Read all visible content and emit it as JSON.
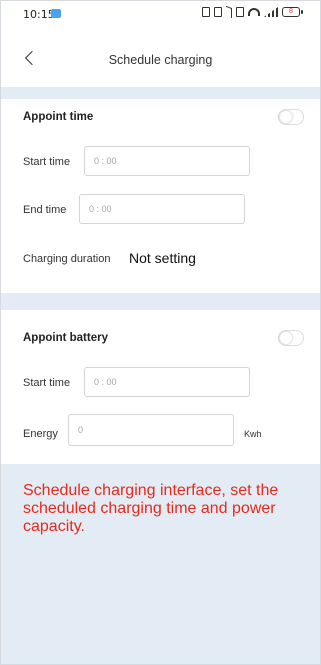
{
  "status_bar": {
    "time": "10:15",
    "battery": "8"
  },
  "header": {
    "title": "Schedule charging"
  },
  "appoint_time": {
    "title": "Appoint time",
    "start_label": "Start time",
    "start_placeholder": "0 : 00",
    "end_label": "End time",
    "end_placeholder": "0 : 00",
    "duration_label": "Charging duration",
    "duration_value": "Not setting",
    "enabled": false
  },
  "appoint_battery": {
    "title": "Appoint battery",
    "start_label": "Start time",
    "start_placeholder": "0 : 00",
    "energy_label": "Energy",
    "energy_placeholder": "0",
    "energy_unit": "Kwh",
    "enabled": false
  },
  "caption": "Schedule charging interface, set the scheduled charging time and power capacity.",
  "colors": {
    "band": "#e3ebf5",
    "caption_text": "#e8291c"
  }
}
